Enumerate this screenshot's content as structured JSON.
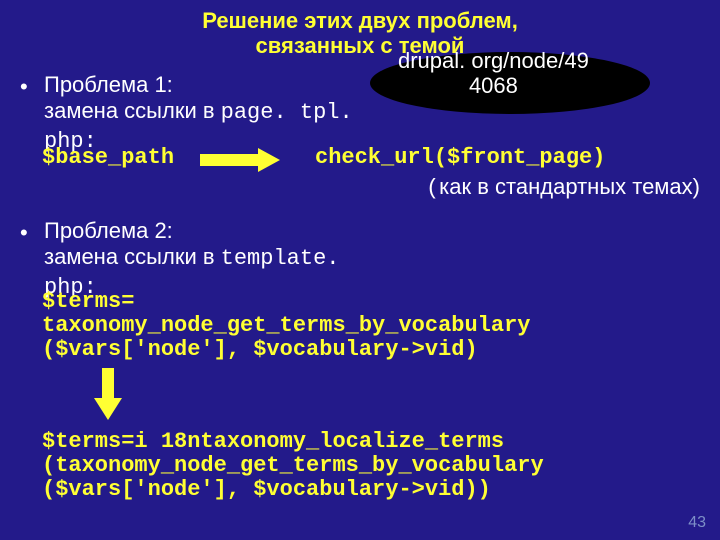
{
  "title_line1": "Решение этих двух проблем,",
  "title_line2": "связанных с темой",
  "callout_line1": "drupal. org/node/49",
  "callout_line2": "4068",
  "problem1_label": "Проблема 1:",
  "problem1_text": "замена ссылки в ",
  "problem1_code": "page. tpl. php:",
  "code_left": "$base_path",
  "code_right": "check_url($front_page)",
  "note_prefix": "(",
  "note_text": "как в стандартных темах)",
  "problem2_label": "Проблема 2:",
  "problem2_text": "замена ссылки в ",
  "problem2_code": "template. php:",
  "codeblock1": "$terms=\ntaxonomy_node_get_terms_by_vocabulary\n($vars['node'], $vocabulary->vid)",
  "codeblock2": "$terms=i 18ntaxonomy_localize_terms\n(taxonomy_node_get_terms_by_vocabulary\n($vars['node'], $vocabulary->vid))",
  "page_number": "43"
}
